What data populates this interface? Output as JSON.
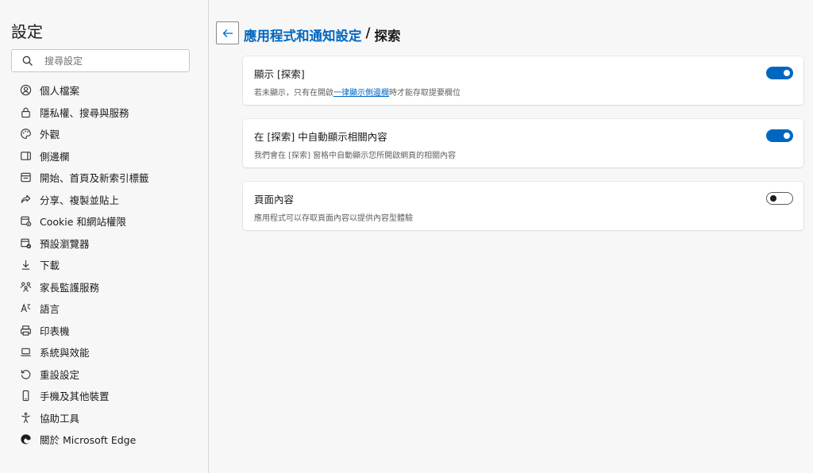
{
  "sidebar": {
    "title": "設定",
    "search_placeholder": "搜尋設定",
    "items": [
      {
        "label": "個人檔案",
        "icon": "profile-icon"
      },
      {
        "label": "隱私權、搜尋與服務",
        "icon": "lock-icon"
      },
      {
        "label": "外觀",
        "icon": "palette-icon"
      },
      {
        "label": "側邊欄",
        "icon": "sidebar-icon"
      },
      {
        "label": "開始、首頁及新索引標籤",
        "icon": "home-tab-icon"
      },
      {
        "label": "分享、複製並貼上",
        "icon": "share-icon"
      },
      {
        "label": "Cookie 和網站權限",
        "icon": "site-permissions-icon"
      },
      {
        "label": "預設瀏覽器",
        "icon": "default-browser-icon"
      },
      {
        "label": "下載",
        "icon": "download-icon"
      },
      {
        "label": "家長監護服務",
        "icon": "family-icon"
      },
      {
        "label": "語言",
        "icon": "language-icon"
      },
      {
        "label": "印表機",
        "icon": "printer-icon"
      },
      {
        "label": "系統與效能",
        "icon": "laptop-icon"
      },
      {
        "label": "重設設定",
        "icon": "reset-icon"
      },
      {
        "label": "手機及其他裝置",
        "icon": "phone-icon"
      },
      {
        "label": "協助工具",
        "icon": "accessibility-icon"
      },
      {
        "label": "關於 Microsoft Edge",
        "icon": "edge-logo-icon"
      }
    ]
  },
  "header": {
    "parent": "應用程式和通知設定",
    "separator": "/",
    "current": "探索"
  },
  "settings": [
    {
      "title": "顯示 [探索]",
      "desc_before": "若未顯示，只有在開啟",
      "desc_link": "一律顯示側邊欄",
      "desc_after": "時才能存取提要欄位",
      "enabled": true
    },
    {
      "title": "在 [探索] 中自動顯示相關內容",
      "desc_before": "我們會在 [探索] 窗格中自動顯示您所開啟網頁的相關內容",
      "desc_link": "",
      "desc_after": "",
      "enabled": true
    },
    {
      "title": "頁面內容",
      "desc_before": "應用程式可以存取頁面內容以提供內容型體驗",
      "desc_link": "",
      "desc_after": "",
      "enabled": false
    }
  ],
  "colors": {
    "accent": "#0067c0",
    "background": "#f7f7f7",
    "card": "#ffffff"
  }
}
